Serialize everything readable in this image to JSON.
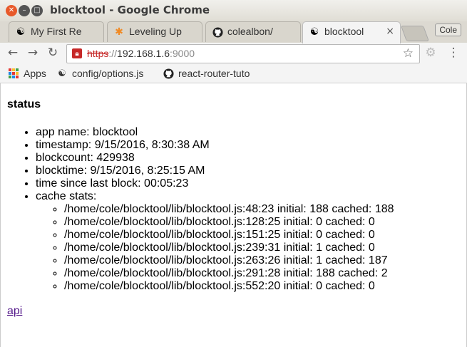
{
  "window": {
    "title": "blocktool - Google Chrome"
  },
  "tabs": [
    {
      "title": "My First Re",
      "icon": "yin-yang-icon"
    },
    {
      "title": "Leveling Up",
      "icon": "asterisk-icon"
    },
    {
      "title": "colealbon/",
      "icon": "github-icon"
    },
    {
      "title": "blocktool",
      "icon": "yin-yang-icon",
      "active": true,
      "close": "×"
    }
  ],
  "profile": {
    "name": "Cole"
  },
  "toolbar": {
    "url_scheme": "https",
    "url_sep": "://",
    "url_host": "192.168.1.6",
    "url_port": ":9000"
  },
  "bookmarks": [
    {
      "label": "Apps",
      "icon": "apps-grid-icon"
    },
    {
      "label": "config/options.js",
      "icon": "yin-yang-icon"
    },
    {
      "label": "react-router-tuto",
      "icon": "github-icon"
    }
  ],
  "page": {
    "heading": "status",
    "items": [
      "app name: blocktool",
      "timestamp: 9/15/2016, 8:30:38 AM",
      "blockcount: 429938",
      "blocktime: 9/15/2016, 8:25:15 AM",
      "time since last block: 00:05:23",
      "cache stats:"
    ],
    "cache_stats": [
      "/home/cole/blocktool/lib/blocktool.js:48:23 initial: 188 cached: 188",
      "/home/cole/blocktool/lib/blocktool.js:128:25 initial: 0 cached: 0",
      "/home/cole/blocktool/lib/blocktool.js:151:25 initial: 0 cached: 0",
      "/home/cole/blocktool/lib/blocktool.js:239:31 initial: 1 cached: 0",
      "/home/cole/blocktool/lib/blocktool.js:263:26 initial: 1 cached: 187",
      "/home/cole/blocktool/lib/blocktool.js:291:28 initial: 188 cached: 2",
      "/home/cole/blocktool/lib/blocktool.js:552:20 initial: 0 cached: 0"
    ],
    "api_link": "api"
  }
}
